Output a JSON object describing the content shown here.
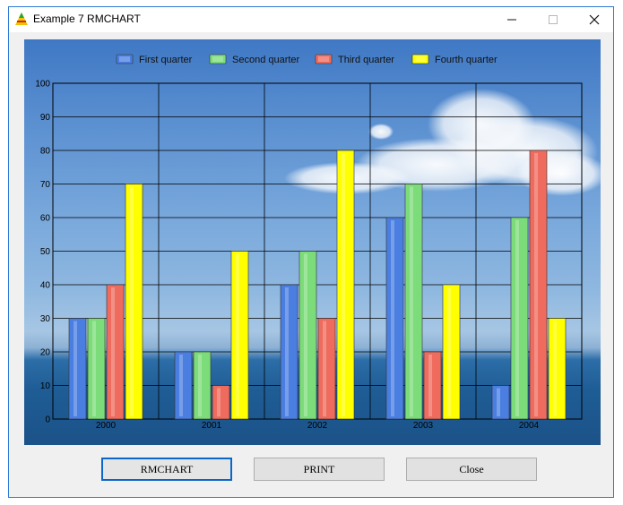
{
  "window": {
    "title": "Example 7 RMCHART"
  },
  "buttons": {
    "rmchart": "RMCHART",
    "print": "PRINT",
    "close": "Close"
  },
  "chart_data": {
    "type": "bar",
    "categories": [
      "2000",
      "2001",
      "2002",
      "2003",
      "2004"
    ],
    "series": [
      {
        "name": "First quarter",
        "values": [
          30,
          20,
          40,
          60,
          10
        ],
        "color": "#4a7ee0"
      },
      {
        "name": "Second quarter",
        "values": [
          30,
          20,
          50,
          70,
          60
        ],
        "color": "#7ddc7a"
      },
      {
        "name": "Third quarter",
        "values": [
          40,
          10,
          30,
          20,
          80
        ],
        "color": "#ef6b5e"
      },
      {
        "name": "Fourth quarter",
        "values": [
          70,
          50,
          80,
          40,
          30
        ],
        "color": "#ffff00"
      }
    ],
    "yticks": [
      "0",
      "10",
      "20",
      "30",
      "40",
      "50",
      "60",
      "70",
      "80",
      "90",
      "100"
    ],
    "ylim": [
      0,
      100
    ],
    "grid": true,
    "legend_position": "top"
  }
}
